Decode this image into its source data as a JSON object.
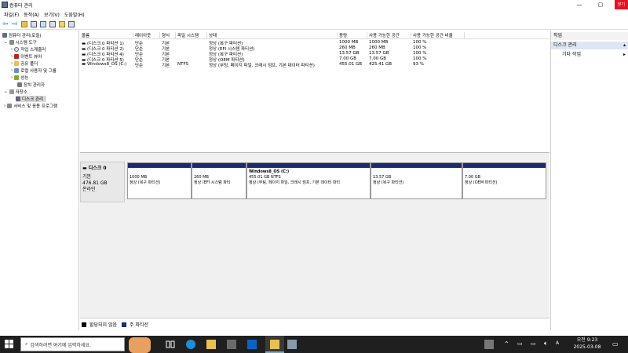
{
  "window": {
    "title": "컴퓨터 관리",
    "tooltip": "닫기"
  },
  "menu": [
    "파일(F)",
    "동작(A)",
    "보기(V)",
    "도움말(H)"
  ],
  "tree": [
    {
      "label": "컴퓨터 관리(로컬)",
      "level": 0,
      "icon": "computer-icon"
    },
    {
      "label": "시스템 도구",
      "level": 1,
      "icon": "tools-icon"
    },
    {
      "label": "작업 스케줄러",
      "level": 2,
      "icon": "clock-icon"
    },
    {
      "label": "이벤트 뷰어",
      "level": 2,
      "icon": "event-icon"
    },
    {
      "label": "공유 폴더",
      "level": 2,
      "icon": "folder-icon"
    },
    {
      "label": "로컬 사용자 및 그룹",
      "level": 2,
      "icon": "users-icon"
    },
    {
      "label": "성능",
      "level": 2,
      "icon": "performance-icon"
    },
    {
      "label": "장치 관리자",
      "level": 2,
      "icon": "device-icon"
    },
    {
      "label": "저장소",
      "level": 1,
      "icon": "storage-icon"
    },
    {
      "label": "디스크 관리",
      "level": 2,
      "icon": "disk-icon",
      "selected": true
    },
    {
      "label": "서비스 및 응용 프로그램",
      "level": 1,
      "icon": "services-icon"
    }
  ],
  "table": {
    "headers": [
      "볼륨",
      "레이아웃",
      "형식",
      "파일 시스템",
      "상태",
      "용량",
      "사용 가능한 공간",
      "사용 가능한 공간 비율"
    ],
    "rows": [
      [
        "(디스크 0 파티션 1)",
        "단순",
        "기본",
        "",
        "정상 (복구 파티션)",
        "1000 MB",
        "1000 MB",
        "100 %"
      ],
      [
        "(디스크 0 파티션 2)",
        "단순",
        "기본",
        "",
        "정상 (EFI 시스템 파티션)",
        "260 MB",
        "260 MB",
        "100 %"
      ],
      [
        "(디스크 0 파티션 4)",
        "단순",
        "기본",
        "",
        "정상 (복구 파티션)",
        "13.57 GB",
        "13.57 GB",
        "100 %"
      ],
      [
        "(디스크 0 파티션 5)",
        "단순",
        "기본",
        "",
        "정상 (OEM 파티션)",
        "7.00 GB",
        "7.00 GB",
        "100 %"
      ],
      [
        "Windows8_OS (C:)",
        "단순",
        "기본",
        "NTFS",
        "정상 (부팅, 페이지 파일, 크래시 덤프, 기본 데이터 파티션)",
        "455.01 GB",
        "425.41 GB",
        "93 %"
      ]
    ]
  },
  "disk": {
    "name": "디스크 0",
    "type": "기본",
    "size": "476.81 GB",
    "status": "온라인"
  },
  "partitions": [
    {
      "name": "",
      "size": "1000 MB",
      "status": "정상 (복구 파티션)"
    },
    {
      "name": "",
      "size": "260 MB",
      "status": "정상 (EFI 시스템 파티"
    },
    {
      "name": "Windows8_OS  (C:)",
      "size": "455.01 GB NTFS",
      "status": "정상 (부팅, 페이지 파일, 크래시 덤프, 기본 데이터 파티"
    },
    {
      "name": "",
      "size": "13.57 GB",
      "status": "정상 (복구 파티션)"
    },
    {
      "name": "",
      "size": "7.00 GB",
      "status": "정상 (OEM 파티션)"
    }
  ],
  "legend": [
    {
      "label": "할당되지 않음",
      "color": "#000000"
    },
    {
      "label": "주 파티션",
      "color": "#1c2a70"
    }
  ],
  "actions": {
    "header": "작업",
    "section": "디스크 관리",
    "item": "기타 작업"
  },
  "taskbar": {
    "search_placeholder": "검색하려면 여기에 입력하세요.",
    "time": "오전 9:23",
    "date": "2025-03-08"
  }
}
